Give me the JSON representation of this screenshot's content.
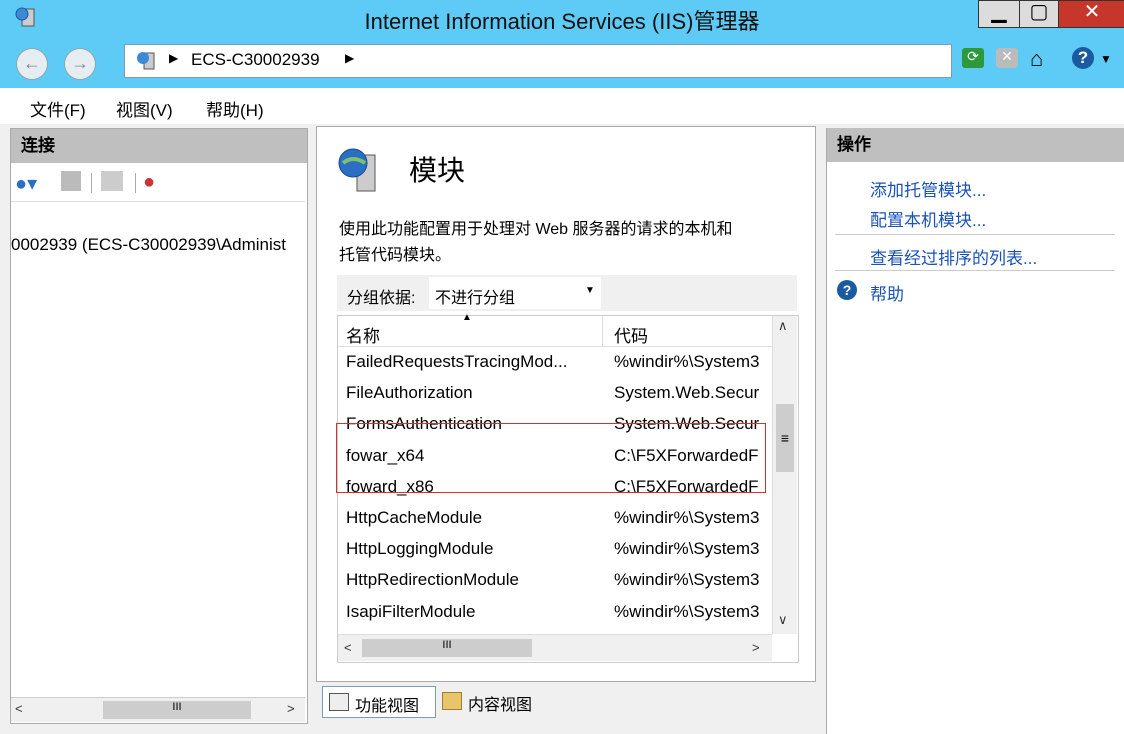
{
  "window": {
    "title": "Internet Information Services (IIS)管理器",
    "min": "▁",
    "max": "▢",
    "close": "✕"
  },
  "address": {
    "crumb": "ECS-C30002939"
  },
  "menu": [
    "文件(F)",
    "视图(V)",
    "帮助(H)"
  ],
  "connections": {
    "header": "连接",
    "tree_item": "0002939 (ECS-C30002939\\Administ"
  },
  "module_page": {
    "title": "模块",
    "description_line1": "使用此功能配置用于处理对 Web 服务器的请求的本机和",
    "description_line2": "托管代码模块。",
    "group_label": "分组依据:",
    "group_value": "不进行分组",
    "col_name": "名称",
    "col_code": "代码",
    "rows": [
      {
        "name": "FailedRequestsTracingMod...",
        "code": "%windir%\\System3"
      },
      {
        "name": "FileAuthorization",
        "code": "System.Web.Secur"
      },
      {
        "name": "FormsAuthentication",
        "code": "System.Web.Secur"
      },
      {
        "name": "fowar_x64",
        "code": "C:\\F5XForwardedF"
      },
      {
        "name": "foward_x86",
        "code": "C:\\F5XForwardedF"
      },
      {
        "name": "HttpCacheModule",
        "code": "%windir%\\System3"
      },
      {
        "name": "HttpLoggingModule",
        "code": "%windir%\\System3"
      },
      {
        "name": "HttpRedirectionModule",
        "code": "%windir%\\System3"
      },
      {
        "name": "IsapiFilterModule",
        "code": "%windir%\\System3"
      }
    ],
    "view_features": "功能视图",
    "view_content": "内容视图"
  },
  "actions": {
    "header": "操作",
    "add_managed": "添加托管模块...",
    "config_native": "配置本机模块...",
    "view_ordered": "查看经过排序的列表...",
    "help": "帮助"
  },
  "colors": {
    "titlebar": "#5ecbf6",
    "link": "#1a52b8",
    "highlight_box": "#d9302c"
  }
}
